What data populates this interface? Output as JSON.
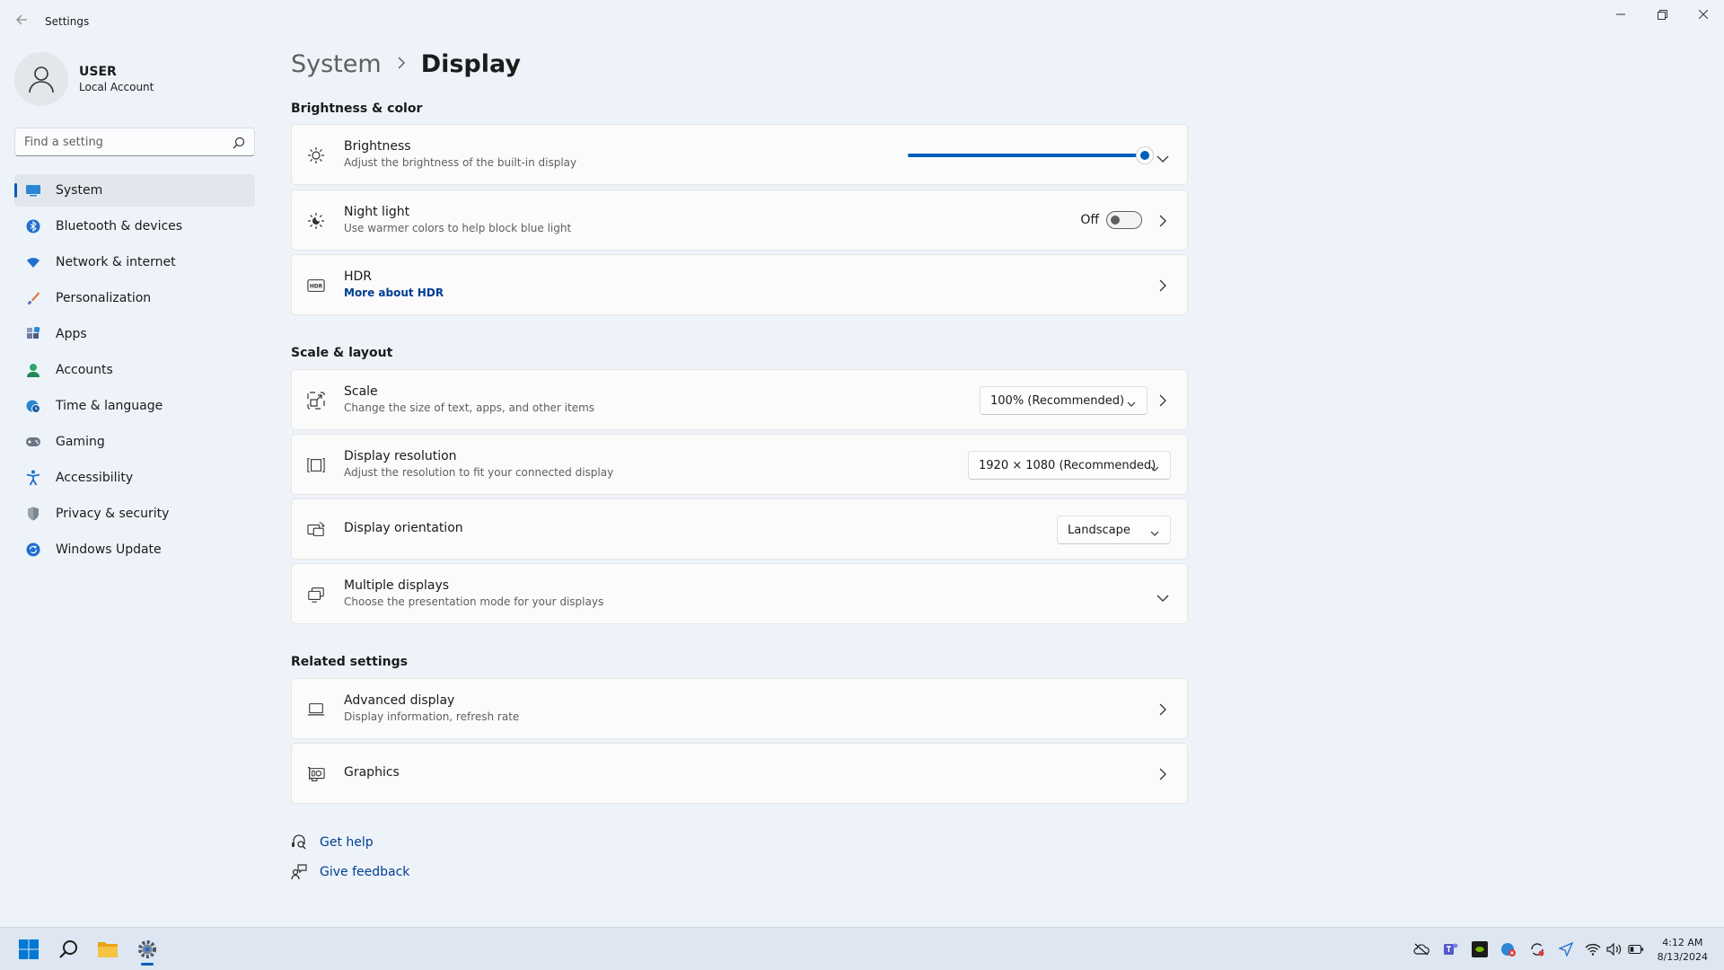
{
  "window": {
    "title": "Settings"
  },
  "profile": {
    "name": "USER",
    "account_type": "Local Account"
  },
  "search": {
    "placeholder": "Find a setting"
  },
  "sidebar": {
    "items": [
      {
        "label": "System",
        "icon": "system-icon",
        "active": true
      },
      {
        "label": "Bluetooth & devices",
        "icon": "bluetooth-icon"
      },
      {
        "label": "Network & internet",
        "icon": "wifi-icon"
      },
      {
        "label": "Personalization",
        "icon": "brush-icon"
      },
      {
        "label": "Apps",
        "icon": "apps-icon"
      },
      {
        "label": "Accounts",
        "icon": "accounts-icon"
      },
      {
        "label": "Time & language",
        "icon": "globe-clock-icon"
      },
      {
        "label": "Gaming",
        "icon": "gamepad-icon"
      },
      {
        "label": "Accessibility",
        "icon": "accessibility-icon"
      },
      {
        "label": "Privacy & security",
        "icon": "shield-icon"
      },
      {
        "label": "Windows Update",
        "icon": "update-icon"
      }
    ]
  },
  "breadcrumb": {
    "parent": "System",
    "current": "Display"
  },
  "sections": {
    "brightness_color": "Brightness & color",
    "scale_layout": "Scale & layout",
    "related": "Related settings"
  },
  "brightness": {
    "title": "Brightness",
    "subtitle": "Adjust the brightness of the built-in display",
    "level_percent": 100
  },
  "night_light": {
    "title": "Night light",
    "subtitle": "Use warmer colors to help block blue light",
    "state_label": "Off",
    "on": false
  },
  "hdr": {
    "title": "HDR",
    "link": "More about HDR"
  },
  "scale": {
    "title": "Scale",
    "subtitle": "Change the size of text, apps, and other items",
    "value": "100% (Recommended)"
  },
  "resolution": {
    "title": "Display resolution",
    "subtitle": "Adjust the resolution to fit your connected display",
    "value": "1920 × 1080 (Recommended)"
  },
  "orientation": {
    "title": "Display orientation",
    "value": "Landscape"
  },
  "multiple_displays": {
    "title": "Multiple displays",
    "subtitle": "Choose the presentation mode for your displays"
  },
  "advanced_display": {
    "title": "Advanced display",
    "subtitle": "Display information, refresh rate"
  },
  "graphics": {
    "title": "Graphics"
  },
  "help": {
    "get_help": "Get help",
    "give_feedback": "Give feedback"
  },
  "taskbar": {
    "apps": [
      "windows-start-icon",
      "search-icon",
      "file-explorer-icon",
      "settings-gear-icon"
    ],
    "tray": [
      "onedrive-icon",
      "teams-icon",
      "nvidia-icon",
      "security-icon",
      "sync-icon",
      "location-icon",
      "wifi-icon",
      "volume-icon",
      "battery-icon"
    ]
  },
  "clock": {
    "time": "4:12 AM",
    "date": "8/13/2024"
  },
  "colors": {
    "accent": "#005fb8",
    "background": "#eef3f9",
    "card": "#fbfbfc",
    "link": "#003e92"
  }
}
